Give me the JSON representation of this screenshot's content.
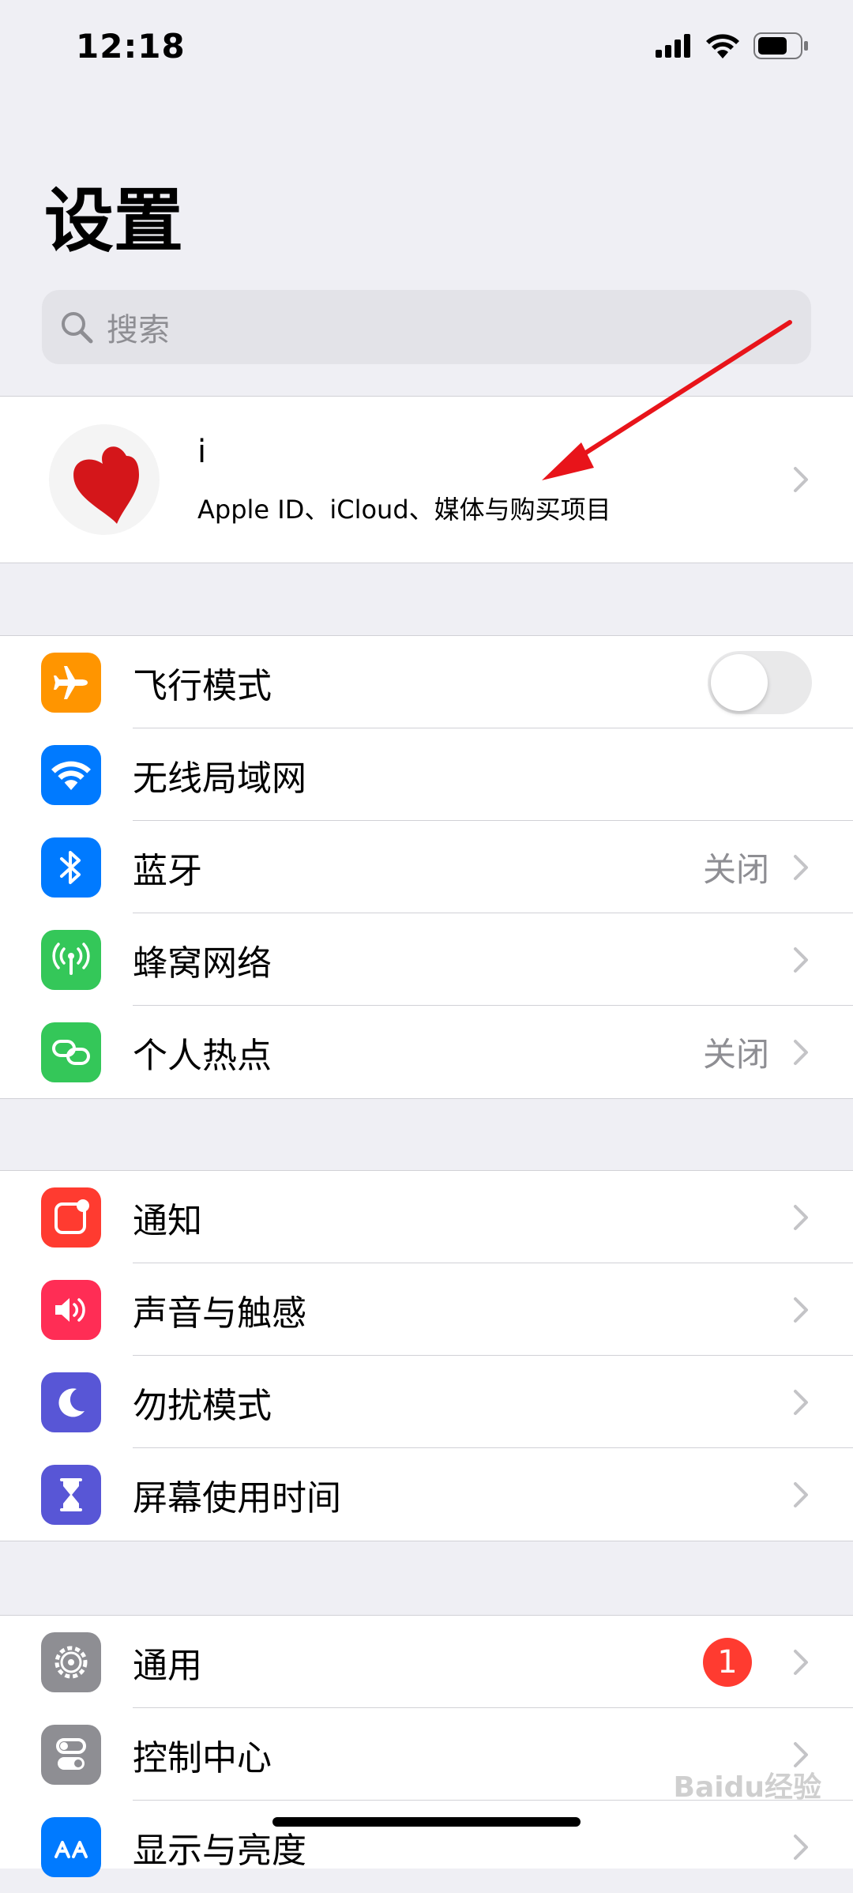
{
  "status_bar": {
    "time": "12:18"
  },
  "title": "设置",
  "search": {
    "placeholder": "搜索"
  },
  "profile": {
    "name": "i",
    "subtitle": "Apple ID、iCloud、媒体与购买项目"
  },
  "section1": [
    {
      "label": "飞行模式",
      "icon": "airplane-icon",
      "color": "#ff9500",
      "toggle": false
    },
    {
      "label": "无线局域网",
      "icon": "wifi-icon",
      "color": "#007aff",
      "value": ""
    },
    {
      "label": "蓝牙",
      "icon": "bluetooth-icon",
      "color": "#007aff",
      "value": "关闭"
    },
    {
      "label": "蜂窝网络",
      "icon": "cellular-icon",
      "color": "#34c759"
    },
    {
      "label": "个人热点",
      "icon": "hotspot-icon",
      "color": "#34c759",
      "value": "关闭"
    }
  ],
  "section2": [
    {
      "label": "通知",
      "icon": "notifications-icon",
      "color": "#ff3b30"
    },
    {
      "label": "声音与触感",
      "icon": "sound-icon",
      "color": "#ff2d55"
    },
    {
      "label": "勿扰模式",
      "icon": "moon-icon",
      "color": "#5856d6"
    },
    {
      "label": "屏幕使用时间",
      "icon": "hourglass-icon",
      "color": "#5856d6"
    }
  ],
  "section3": [
    {
      "label": "通用",
      "icon": "gear-icon",
      "color": "#8e8e93",
      "badge": "1"
    },
    {
      "label": "控制中心",
      "icon": "control-center-icon",
      "color": "#8e8e93"
    },
    {
      "label": "显示与亮度",
      "icon": "display-icon",
      "color": "#007aff"
    }
  ],
  "watermark": "Baidu经验"
}
